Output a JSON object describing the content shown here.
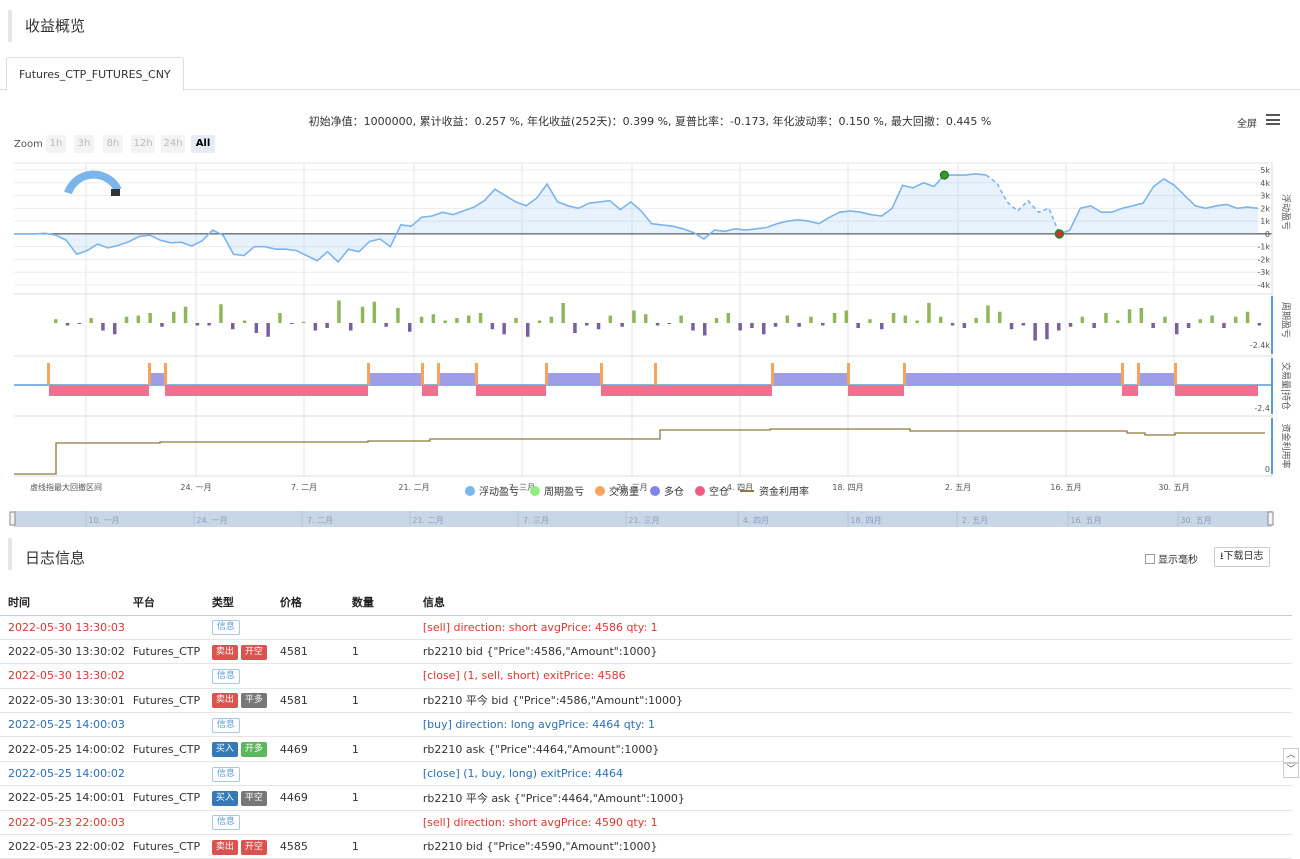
{
  "overview": {
    "title": "收益概览"
  },
  "tabs": [
    {
      "label": "Futures_CTP_FUTURES_CNY"
    }
  ],
  "summary": {
    "text": "初始净值：1000000, 累计收益：0.257 %, 年化收益(252天)：0.399 %, 夏普比率：-0.173, 年化波动率：0.150 %, 最大回撤：0.445 %",
    "fullscreen_label": "全屏"
  },
  "zoom": {
    "label": "Zoom",
    "buttons": [
      "1h",
      "3h",
      "8h",
      "12h",
      "24h",
      "All"
    ],
    "active": "All"
  },
  "chart_data": {
    "type": "line",
    "panes": [
      {
        "name": "浮动盈亏",
        "yticks": [
          "5k",
          "4k",
          "3k",
          "2k",
          "1k",
          "0",
          "-1k",
          "-2k",
          "-3k",
          "-4k"
        ],
        "ylim": [
          -4000,
          5000
        ]
      },
      {
        "name": "周期盈亏",
        "yticks": [
          "-2.4k"
        ]
      },
      {
        "name": "交易量|持仓",
        "yticks": [
          "-2.4"
        ]
      },
      {
        "name": "资金利用率",
        "yticks": [
          "0"
        ]
      }
    ],
    "xticks": [
      "虚线指最大回撤区间",
      "24. 一月",
      "7. 二月",
      "21. 二月",
      "7. 三月",
      "21. 三月",
      "4. 四月",
      "18. 四月",
      "2. 五月",
      "16. 五月",
      "30. 五月"
    ],
    "navigator_ticks": [
      "10. 一月",
      "24. 一月",
      "7. 二月",
      "21. 二月",
      "7. 三月",
      "21. 三月",
      "4. 四月",
      "18. 四月",
      "2. 五月",
      "16. 五月",
      "30. 五月"
    ],
    "legend": [
      {
        "name": "浮动盈亏",
        "color": "#7cb5ec",
        "shape": "dot"
      },
      {
        "name": "周期盈亏",
        "color": "#90ed7d",
        "shape": "dot"
      },
      {
        "name": "交易量",
        "color": "#f7a35c",
        "shape": "dot"
      },
      {
        "name": "多仓",
        "color": "#8085e9",
        "shape": "dot"
      },
      {
        "name": "空仓",
        "color": "#f15c80",
        "shape": "dot"
      },
      {
        "name": "资金利用率",
        "color": "#8d7a3d",
        "shape": "line"
      }
    ],
    "floating_pnl": [
      0,
      0,
      0,
      50,
      -100,
      -500,
      -1600,
      -1300,
      -800,
      -1100,
      -900,
      -600,
      -200,
      -100,
      -500,
      -700,
      -650,
      -950,
      -550,
      300,
      -100,
      -1600,
      -1700,
      -1000,
      -1000,
      -1200,
      -1200,
      -1300,
      -1700,
      -2100,
      -1400,
      -2200,
      -1200,
      -1400,
      -600,
      -400,
      -1000,
      700,
      600,
      1300,
      1400,
      1700,
      1500,
      1800,
      2100,
      2600,
      3500,
      3000,
      2500,
      2200,
      2800,
      3900,
      2500,
      2200,
      2000,
      2400,
      2500,
      2600,
      1900,
      2500,
      1800,
      800,
      700,
      600,
      400,
      100,
      -400,
      300,
      200,
      400,
      300,
      400,
      500,
      800,
      1000,
      1100,
      1000,
      800,
      1300,
      1700,
      1800,
      1700,
      1500,
      1400,
      2000,
      3800,
      3600,
      4000,
      3700,
      4600,
      4600,
      4600,
      4700,
      4600,
      4000,
      2500,
      1800,
      2600,
      1700,
      2000,
      0,
      300,
      2000,
      2200,
      1700,
      1700,
      2000,
      2200,
      2400,
      3700,
      4300,
      3800,
      3000,
      2200,
      2000,
      2200,
      2300,
      2000,
      2100,
      2000
    ],
    "capital_utilization_note": "step line"
  },
  "log": {
    "title": "日志信息",
    "show_ms_label": "显示毫秒",
    "download_label": "下载日志",
    "columns": [
      "时间",
      "平台",
      "类型",
      "价格",
      "数量",
      "信息"
    ],
    "rows": [
      {
        "style": "red",
        "time": "2022-05-30 13:30:03",
        "platform": "",
        "tags": [
          [
            "信息",
            "info"
          ]
        ],
        "price": "",
        "qty": "",
        "msg": "[sell] direction: short avgPrice: 4586 qty: 1"
      },
      {
        "style": "",
        "time": "2022-05-30 13:30:02",
        "platform": "Futures_CTP",
        "tags": [
          [
            "卖出",
            "sell"
          ],
          [
            "开空",
            "open-short"
          ]
        ],
        "price": "4581",
        "qty": "1",
        "msg": "rb2210 bid {\"Price\":4586,\"Amount\":1000}"
      },
      {
        "style": "red",
        "time": "2022-05-30 13:30:02",
        "platform": "",
        "tags": [
          [
            "信息",
            "info"
          ]
        ],
        "price": "",
        "qty": "",
        "msg": "[close] (1, sell, short) exitPrice: 4586"
      },
      {
        "style": "",
        "time": "2022-05-30 13:30:01",
        "platform": "Futures_CTP",
        "tags": [
          [
            "卖出",
            "sell"
          ],
          [
            "平多",
            "close-long"
          ]
        ],
        "price": "4581",
        "qty": "1",
        "msg": "rb2210 平今 bid {\"Price\":4586,\"Amount\":1000}"
      },
      {
        "style": "blue",
        "time": "2022-05-25 14:00:03",
        "platform": "",
        "tags": [
          [
            "信息",
            "info"
          ]
        ],
        "price": "",
        "qty": "",
        "msg": "[buy] direction: long avgPrice: 4464 qty: 1"
      },
      {
        "style": "",
        "time": "2022-05-25 14:00:02",
        "platform": "Futures_CTP",
        "tags": [
          [
            "买入",
            "buy"
          ],
          [
            "开多",
            "open-long"
          ]
        ],
        "price": "4469",
        "qty": "1",
        "msg": "rb2210 ask {\"Price\":4464,\"Amount\":1000}"
      },
      {
        "style": "blue",
        "time": "2022-05-25 14:00:02",
        "platform": "",
        "tags": [
          [
            "信息",
            "info"
          ]
        ],
        "price": "",
        "qty": "",
        "msg": "[close] (1, buy, long) exitPrice: 4464"
      },
      {
        "style": "",
        "time": "2022-05-25 14:00:01",
        "platform": "Futures_CTP",
        "tags": [
          [
            "买入",
            "buy"
          ],
          [
            "平空",
            "close-short"
          ]
        ],
        "price": "4469",
        "qty": "1",
        "msg": "rb2210 平今 ask {\"Price\":4464,\"Amount\":1000}"
      },
      {
        "style": "red",
        "time": "2022-05-23 22:00:03",
        "platform": "",
        "tags": [
          [
            "信息",
            "info"
          ]
        ],
        "price": "",
        "qty": "",
        "msg": "[sell] direction: short avgPrice: 4590 qty: 1"
      },
      {
        "style": "",
        "time": "2022-05-23 22:00:02",
        "platform": "Futures_CTP",
        "tags": [
          [
            "卖出",
            "sell"
          ],
          [
            "开空",
            "open-short"
          ]
        ],
        "price": "4585",
        "qty": "1",
        "msg": "rb2210 bid {\"Price\":4590,\"Amount\":1000}"
      }
    ]
  }
}
